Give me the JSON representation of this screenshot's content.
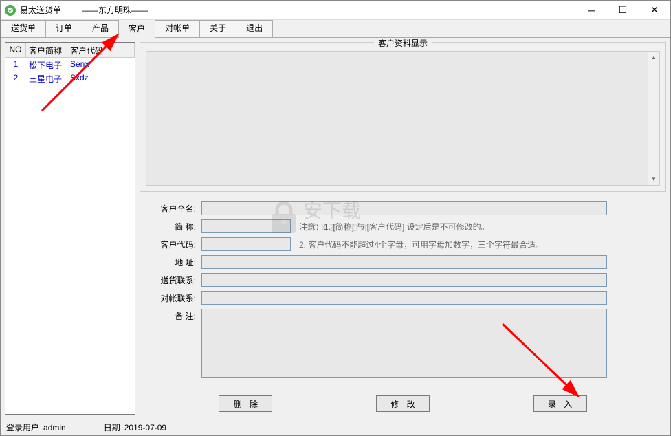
{
  "titlebar": {
    "title": "易太送货单",
    "subtitle": "——东方明珠——"
  },
  "tabs": [
    {
      "label": "送货单"
    },
    {
      "label": "订单"
    },
    {
      "label": "产品"
    },
    {
      "label": "客户",
      "active": true
    },
    {
      "label": "对帐单"
    },
    {
      "label": "关于"
    },
    {
      "label": "退出"
    }
  ],
  "customer_table": {
    "headers": {
      "no": "NO",
      "name": "客户简称",
      "code": "客户代码"
    },
    "rows": [
      {
        "no": "1",
        "name": "松下电子",
        "code": "Senx"
      },
      {
        "no": "2",
        "name": "三星电子",
        "code": "Sxdz"
      }
    ]
  },
  "display_group_title": "客户资料显示",
  "form": {
    "labels": {
      "fullname": "客户全名:",
      "shortname": "简 称:",
      "code": "客户代码:",
      "address": "地 址:",
      "delivery_contact": "送货联系:",
      "account_contact": "对帐联系:",
      "remark": "备 注:"
    },
    "hints": {
      "shortname": "注意：1. [简称] 与 [客户代码] 设定后是不可修改的。",
      "code": "2. 客户代码不能超过4个字母，可用字母加数字，三个字符最合适。"
    }
  },
  "buttons": {
    "delete": "删 除",
    "modify": "修 改",
    "enter": "录 入"
  },
  "statusbar": {
    "user_label": "登录用户",
    "user_value": "admin",
    "date_label": "日期",
    "date_value": "2019-07-09"
  },
  "watermark": {
    "text_main": "安下载",
    "text_sub": "anxz.com"
  }
}
